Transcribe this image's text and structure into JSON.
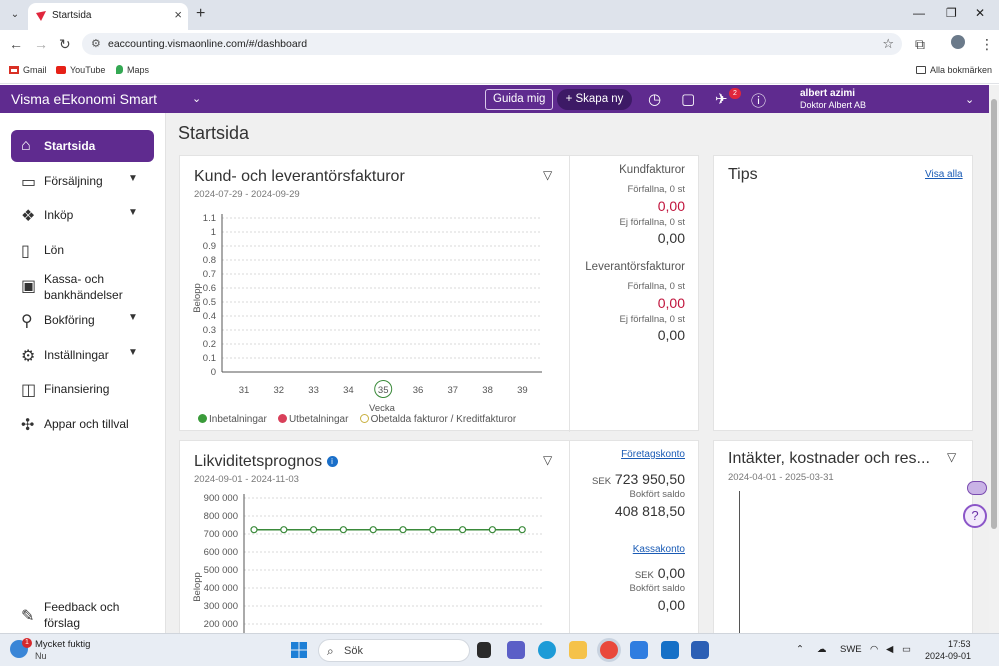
{
  "browser": {
    "tab_title": "Startsida",
    "url": "eaccounting.vismaonline.com/#/dashboard",
    "bookmarks": [
      "Gmail",
      "YouTube",
      "Maps"
    ],
    "all_bookmarks": "Alla bokmärken"
  },
  "header": {
    "brand": "Visma eEkonomi Smart",
    "guide_button": "Guida mig",
    "create_button": "Skapa ny",
    "notification_count": "2",
    "user_name": "albert azimi",
    "company": "Doktor Albert AB"
  },
  "sidebar": {
    "items": [
      {
        "label": "Startsida",
        "icon": "home-icon"
      },
      {
        "label": "Försäljning",
        "icon": "sales-icon"
      },
      {
        "label": "Inköp",
        "icon": "purchase-icon"
      },
      {
        "label": "Lön",
        "icon": "salary-icon"
      },
      {
        "label": "Kassa- och bankhändelser",
        "icon": "bank-icon"
      },
      {
        "label": "Bokföring",
        "icon": "bookkeeping-icon"
      },
      {
        "label": "Inställningar",
        "icon": "settings-icon"
      },
      {
        "label": "Finansiering",
        "icon": "financing-icon"
      },
      {
        "label": "Appar och tillval",
        "icon": "puzzle-icon"
      }
    ],
    "feedback": "Feedback och förslag"
  },
  "main": {
    "page_title": "Startsida",
    "invoices_card": {
      "title": "Kund- och leverantörsfakturor",
      "date_range": "2024-07-29 - 2024-09-29",
      "ylabel": "Belopp",
      "xlabel": "Vecka",
      "legend": [
        "Inbetalningar",
        "Utbetalningar",
        "Obetalda fakturor / Kreditfakturor"
      ],
      "customer_heading": "Kundfakturor",
      "customer_overdue_label": "Förfallna, 0 st",
      "customer_overdue_value": "0,00",
      "customer_notdue_label": "Ej förfallna, 0 st",
      "customer_notdue_value": "0,00",
      "supplier_heading": "Leverantörsfakturor",
      "supplier_overdue_label": "Förfallna, 0 st",
      "supplier_overdue_value": "0,00",
      "supplier_notdue_label": "Ej förfallna, 0 st",
      "supplier_notdue_value": "0,00"
    },
    "tips_card": {
      "title": "Tips",
      "link": "Visa alla"
    },
    "liquidity_card": {
      "title": "Likviditetsprognos",
      "date_range": "2024-09-01 - 2024-11-03",
      "ylabel": "Belopp",
      "company_account_link": "Företagskonto",
      "company_currency": "SEK",
      "company_balance": "723 950,50",
      "company_booked_label": "Bokfört saldo",
      "company_booked_value": "408 818,50",
      "cash_account_link": "Kassakonto",
      "cash_currency": "SEK",
      "cash_balance": "0,00",
      "cash_booked_label": "Bokfört saldo",
      "cash_booked_value": "0,00"
    },
    "income_card": {
      "title": "Intäkter, kostnader och res...",
      "date_range": "2024-04-01 - 2025-03-31"
    }
  },
  "chart_data": [
    {
      "type": "line",
      "title": "Kund- och leverantörsfakturor",
      "xlabel": "Vecka",
      "ylabel": "Belopp",
      "categories": [
        "31",
        "32",
        "33",
        "34",
        "35",
        "36",
        "37",
        "38",
        "39"
      ],
      "highlighted_category": "35",
      "yticks": [
        "1.1",
        "1",
        "0.9",
        "0.8",
        "0.7",
        "0.6",
        "0.5",
        "0.4",
        "0.3",
        "0.2",
        "0.1",
        "0"
      ],
      "ylim": [
        0,
        1.1
      ],
      "series": [
        {
          "name": "Inbetalningar",
          "color": "#3a9b3a",
          "values": []
        },
        {
          "name": "Utbetalningar",
          "color": "#d9405a",
          "values": []
        },
        {
          "name": "Obetalda fakturor / Kreditfakturor",
          "color": "#e8d46a",
          "values": []
        }
      ]
    },
    {
      "type": "line",
      "title": "Likviditetsprognos",
      "ylabel": "Belopp",
      "yticks": [
        "900 000",
        "800 000",
        "700 000",
        "600 000",
        "500 000",
        "400 000",
        "300 000",
        "200 000"
      ],
      "ylim": [
        200000,
        900000
      ],
      "series": [
        {
          "color": "#3a8a3a",
          "values": [
            723950,
            723950,
            723950,
            723950,
            723950,
            723950,
            723950,
            723950,
            723950,
            723950
          ]
        }
      ]
    }
  ],
  "taskbar": {
    "weather_title": "Mycket fuktig",
    "weather_sub": "Nu",
    "weather_badge": "1",
    "search_placeholder": "Sök",
    "language": "SWE",
    "time": "17:53",
    "date": "2024-09-01"
  },
  "colors": {
    "brand_purple": "#5f2b8f",
    "negative_red": "#c0143c",
    "link_blue": "#1a5bb5"
  }
}
